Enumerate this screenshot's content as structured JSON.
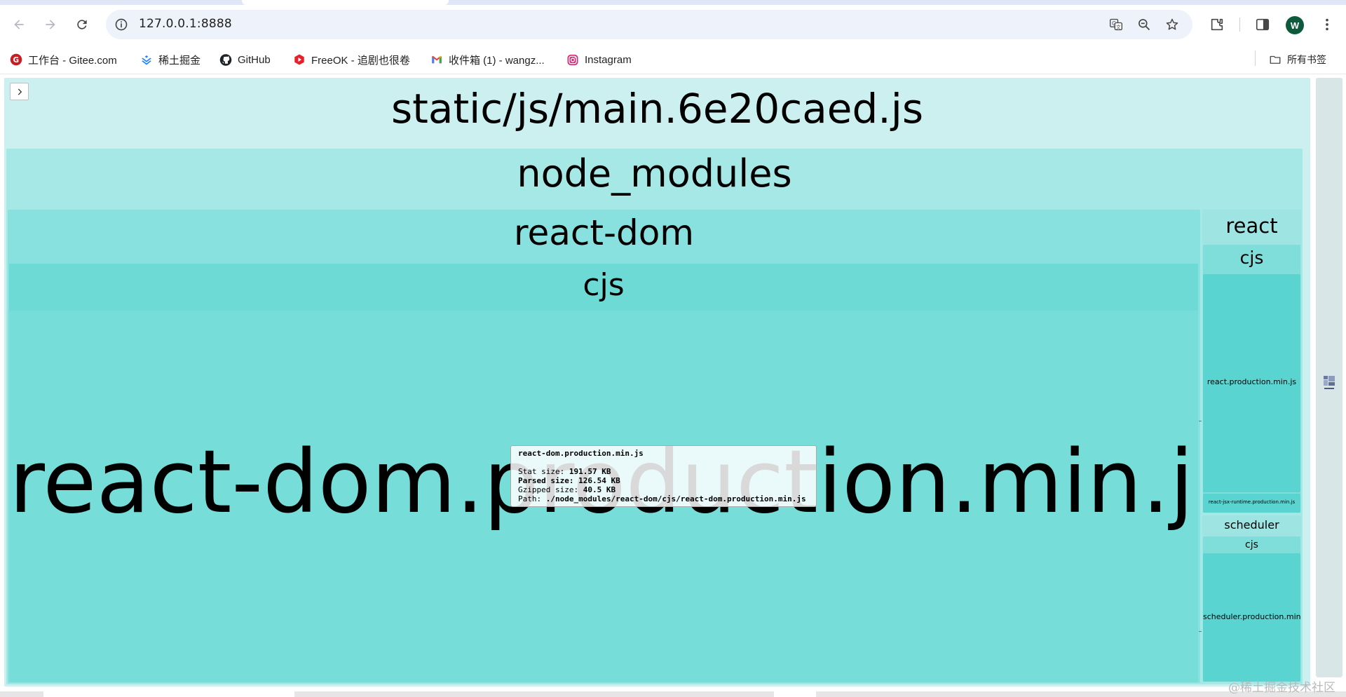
{
  "browser": {
    "url": "127.0.0.1:8888",
    "avatar_letter": "W",
    "bookmarks": [
      {
        "label": "工作台 - Gitee.com",
        "icon": "gitee-icon",
        "color": "#c71d23"
      },
      {
        "label": "稀土掘金",
        "icon": "juejin-icon",
        "color": "#1e80ff"
      },
      {
        "label": "GitHub",
        "icon": "github-icon",
        "color": "#1f2328"
      },
      {
        "label": "FreeOK - 追剧也很卷",
        "icon": "freeok-icon",
        "color": "#e8202c"
      },
      {
        "label": "收件箱 (1) - wangz...",
        "icon": "gmail-icon",
        "color": "#ea4335"
      },
      {
        "label": "Instagram",
        "icon": "instagram-icon",
        "color": "#d62976"
      }
    ],
    "all_bookmarks_label": "所有书签"
  },
  "treemap": {
    "root": "static/js/main.6e20caed.js",
    "node_modules": "node_modules",
    "react_dom": "react-dom",
    "react_dom_cjs": "cjs",
    "react_dom_file": "react-dom.production.min.js",
    "react": "react",
    "react_cjs": "cjs",
    "react_file": "react.production.min.js",
    "react_jsx_file": "react-jsx-runtime.production.min.js",
    "scheduler": "scheduler",
    "scheduler_cjs": "cjs",
    "scheduler_file": "scheduler.production.min.js",
    "colors": {
      "root": "#cbf0ef",
      "node_modules": "#a6e8e6",
      "react_dom": "#88e1de",
      "cjs": "#6edad6",
      "file": "#76ddd9",
      "react_group": "#9de4e2",
      "react_file": "#5ad4d0"
    }
  },
  "tooltip": {
    "title": "react-dom.production.min.js",
    "stat_label": "Stat size:",
    "stat_value": "191.57 KB",
    "parsed_label": "Parsed size:",
    "parsed_value": "126.54 KB",
    "gzip_label": "Gzipped size:",
    "gzip_value": "40.5 KB",
    "path_label": "Path:",
    "path_value": "./node_modules/react-dom/cjs/react-dom.production.min.js"
  },
  "watermark": "@稀土掘金技术社区"
}
